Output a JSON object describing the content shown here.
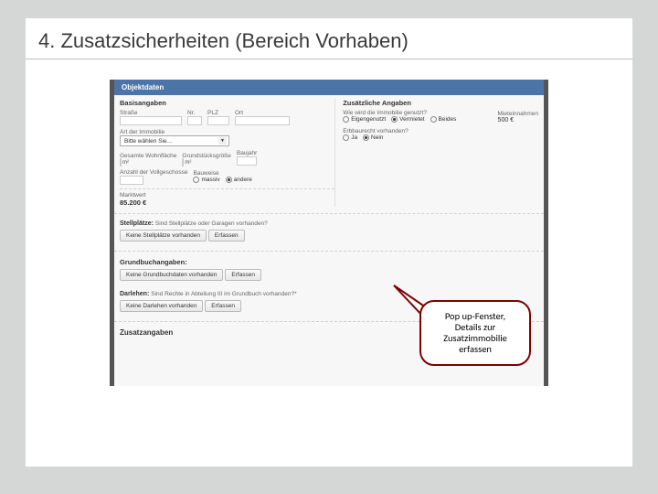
{
  "slide": {
    "heading": "4. Zusatzsicherheiten (Bereich Vorhaben)"
  },
  "popup": {
    "title": "Objektdaten",
    "basis": {
      "heading": "Basisangaben",
      "street_label": "Straße",
      "nr_label": "Nr.",
      "plz_label": "PLZ",
      "ort_label": "Ort",
      "type_label": "Art der Immobilie",
      "type_placeholder": "Bitte wählen Sie…",
      "wohn_label": "Gesamte Wohnfläche",
      "grund_label": "Grundstücksgröße",
      "baujahr_label": "Baujahr",
      "unit_m2": "m²",
      "anzahl_label": "Anzahl der Vollgeschosse",
      "bauweise_label": "Bauweise",
      "bw_massiv": "massiv",
      "bw_andere": "andere",
      "marktwert_label": "Marktwert",
      "marktwert_value": "85.200 €"
    },
    "zusatz": {
      "heading": "Zusätzliche Angaben",
      "nutzung_label": "Wie wird die Immobilie genutzt?",
      "nutzung_eigen": "Eigengenutzt",
      "nutzung_vermietet": "Vermietet",
      "nutzung_beides": "Beides",
      "miet_label": "Mieteinnahmen",
      "miet_value": "500 €",
      "erb_label": "Erbbaurecht vorhanden?",
      "erb_ja": "Ja",
      "erb_nein": "Nein"
    },
    "stell": {
      "heading": "Stellplätze:",
      "text": "Sind Stellplätze oder Garagen vorhanden?",
      "btn1": "Keine Stellplätze vorhanden",
      "btn2": "Erfassen"
    },
    "grundbuch": {
      "heading": "Grundbuchangaben:",
      "btn1": "Keine Grundbuchdaten vorhanden",
      "btn2": "Erfassen"
    },
    "darlehen": {
      "label": "Darlehen:",
      "text": "Sind Rechte in Abteilung III im Grundbuch vorhanden?*",
      "btn1": "Keine Darlehen vorhanden",
      "btn2": "Erfassen"
    },
    "zusatzangaben": "Zusatzangaben"
  },
  "callout": {
    "line1": "Pop up-Fenster,",
    "line2": "Details zur",
    "line3": "Zusatzimmobilie",
    "line4": "erfassen"
  }
}
